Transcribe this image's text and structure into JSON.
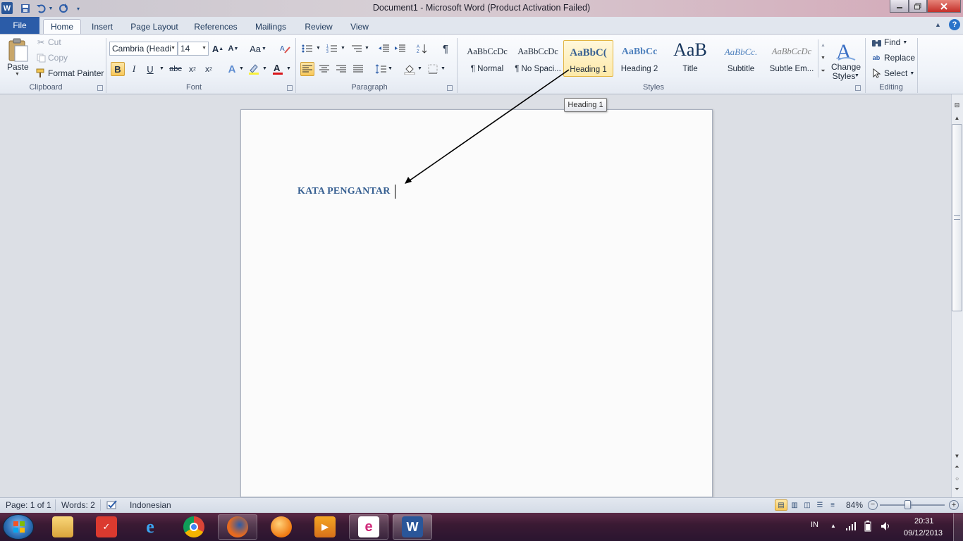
{
  "window": {
    "title": "Document1  -  Microsoft Word (Product Activation Failed)"
  },
  "tabs": [
    "File",
    "Home",
    "Insert",
    "Page Layout",
    "References",
    "Mailings",
    "Review",
    "View"
  ],
  "clipboard": {
    "paste": "Paste",
    "cut": "Cut",
    "copy": "Copy",
    "format_painter": "Format Painter",
    "label": "Clipboard"
  },
  "font": {
    "name": "Cambria (Headi",
    "size": "14",
    "case": "Aa",
    "label": "Font"
  },
  "paragraph": {
    "label": "Paragraph"
  },
  "styles": {
    "label": "Styles",
    "items": [
      {
        "preview": "AaBbCcDc",
        "name": "¶ Normal"
      },
      {
        "preview": "AaBbCcDc",
        "name": "¶ No Spaci..."
      },
      {
        "preview": "AaBbC(",
        "name": "Heading 1"
      },
      {
        "preview": "AaBbCc",
        "name": "Heading 2"
      },
      {
        "preview": "AaB",
        "name": "Title"
      },
      {
        "preview": "AaBbCc.",
        "name": "Subtitle"
      },
      {
        "preview": "AaBbCcDc",
        "name": "Subtle Em..."
      }
    ],
    "change_styles": [
      "Change",
      "Styles"
    ]
  },
  "editing": {
    "find": "Find",
    "replace": "Replace",
    "select": "Select",
    "label": "Editing"
  },
  "tooltip": "Heading 1",
  "document": {
    "heading": "KATA PENGANTAR"
  },
  "status": {
    "page": "Page: 1 of 1",
    "words": "Words: 2",
    "language": "Indonesian",
    "zoom": "84%"
  },
  "taskbar": {
    "lang": "IN",
    "time": "20:31",
    "date": "09/12/2013"
  },
  "colors": {
    "accent": "#2b5ca8",
    "heading": "#365f91",
    "highlight": "#f8c85a"
  }
}
